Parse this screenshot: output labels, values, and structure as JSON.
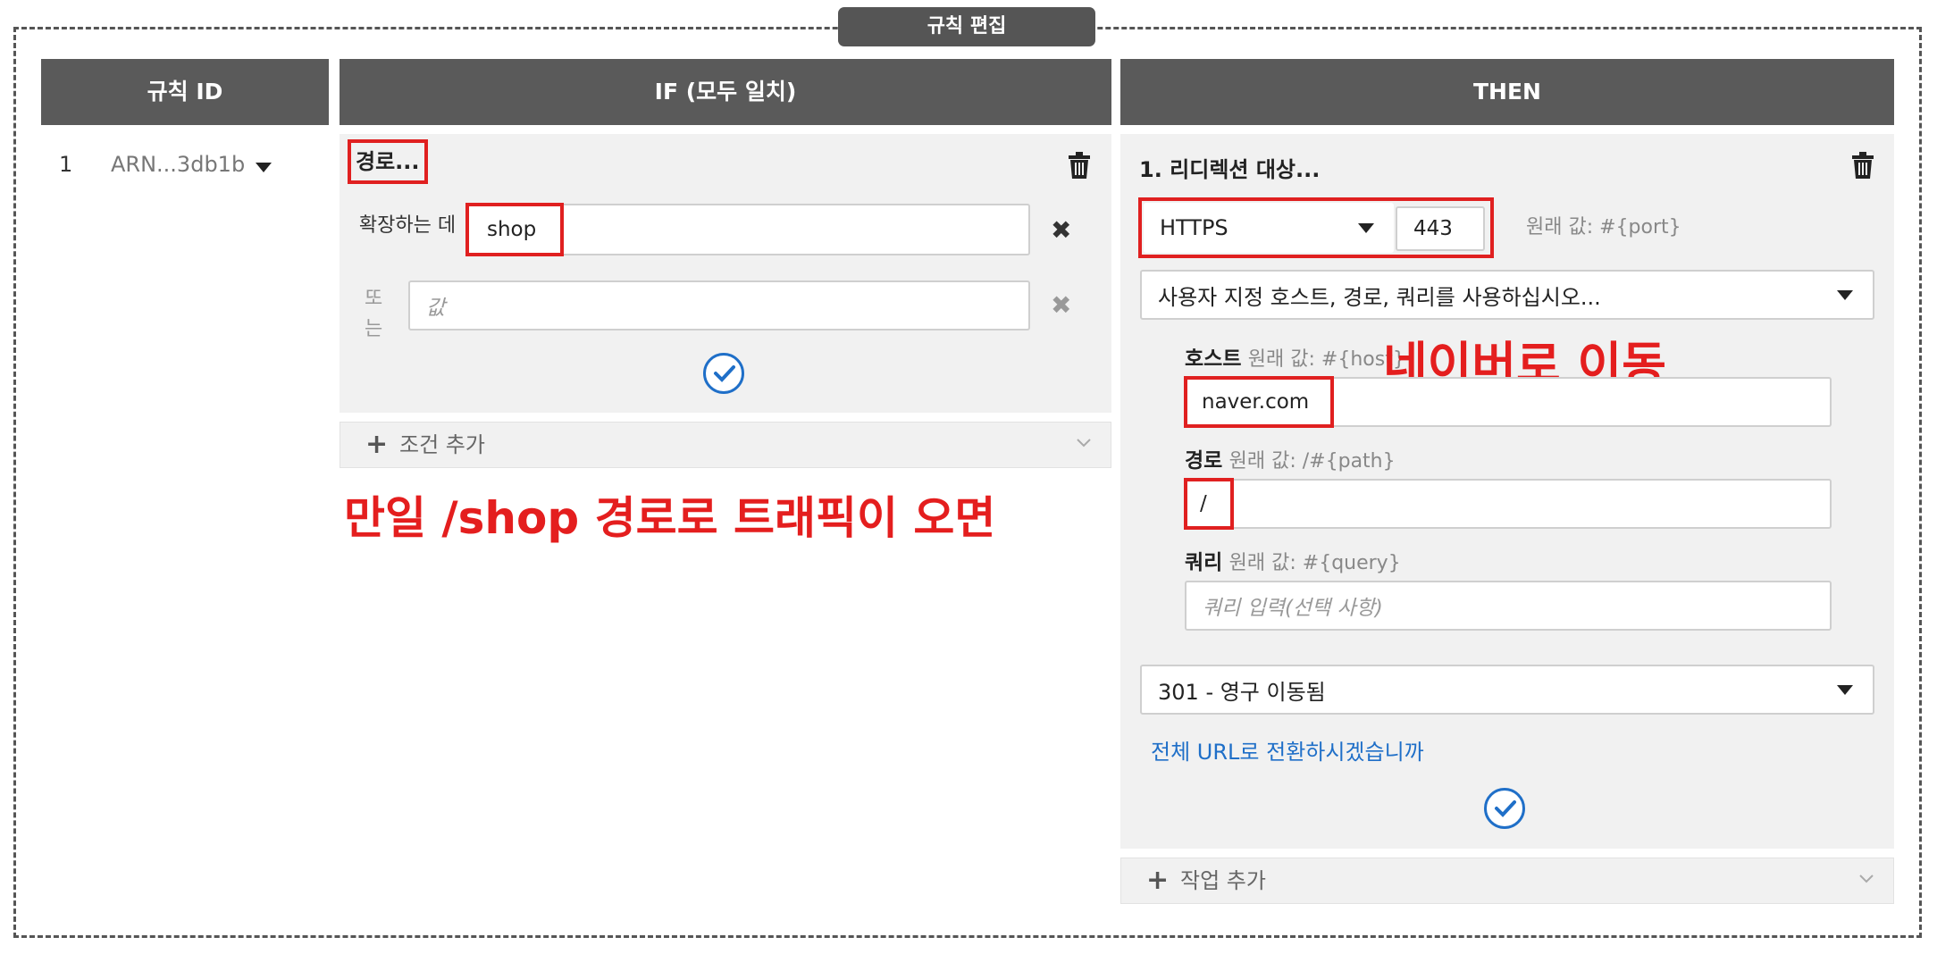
{
  "frame_title": "규칙 편집",
  "headers": {
    "rule_id": "규칙 ID",
    "if": "IF (모두 일치)",
    "then": "THEN"
  },
  "rule": {
    "number": "1",
    "arn": "ARN...3db1b"
  },
  "condition": {
    "type_label": "경로...",
    "match_label": "확장하는 데",
    "value": "shop",
    "or_label": "또는",
    "or_placeholder": "값",
    "add_condition": "조건 추가"
  },
  "action": {
    "title": "1. 리디렉션 대상...",
    "protocol": "HTTPS",
    "port": "443",
    "original_port_hint": "원래 값: #{port}",
    "custom_select": "사용자 지정 호스트, 경로, 쿼리를 사용하십시오...",
    "host_label": "호스트",
    "host_hint": "원래 값: #{host}",
    "host_value": "naver.com",
    "path_label": "경로",
    "path_hint": "원래 값: /#{path}",
    "path_value": "/",
    "query_label": "쿼리",
    "query_hint": "원래 값: #{query}",
    "query_placeholder": "쿼리 입력(선택 사항)",
    "status_code": "301 - 영구 이동됨",
    "full_url_link": "전체 URL로 전환하시겠습니까",
    "add_action": "작업 추가"
  },
  "annotations": {
    "if_note": "만일 /shop 경로로 트래픽이 오면",
    "then_note": "네이버로 이동"
  },
  "colors": {
    "highlight": "#e02020",
    "annotation": "#e41e1e",
    "header": "#5a5a5a",
    "link": "#1f6fc8"
  }
}
